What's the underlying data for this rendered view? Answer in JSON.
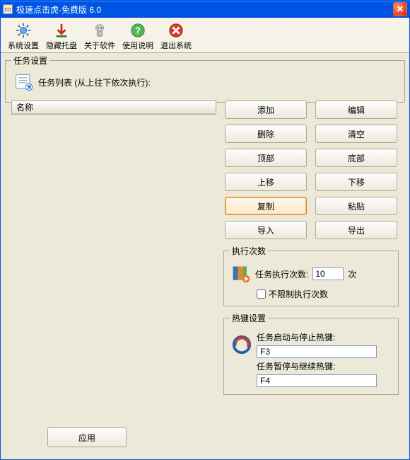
{
  "window": {
    "title": "极速点击虎-免费版 6.0"
  },
  "toolbar": {
    "items": [
      {
        "label": "系统设置"
      },
      {
        "label": "隐藏托盘"
      },
      {
        "label": "关于软件"
      },
      {
        "label": "使用说明"
      },
      {
        "label": "退出系统"
      }
    ]
  },
  "task_settings": {
    "legend": "任务设置",
    "list_caption": "任务列表 (从上往下依次执行):",
    "column_header": "名称",
    "buttons": {
      "add": "添加",
      "edit": "编辑",
      "delete": "删除",
      "clear": "清空",
      "top": "顶部",
      "bottom": "底部",
      "up": "上移",
      "down": "下移",
      "copy": "复制",
      "paste": "粘贴",
      "import": "导入",
      "export": "导出"
    },
    "exec": {
      "legend": "执行次数",
      "label": "任务执行次数:",
      "value": "10",
      "unit": "次",
      "unlimited_label": "不限制执行次数",
      "unlimited_checked": false
    },
    "hotkey": {
      "legend": "热键设置",
      "start_stop_label": "任务启动与停止热键:",
      "start_stop_value": "F3",
      "pause_resume_label": "任务暂停与继续热键:",
      "pause_resume_value": "F4"
    }
  },
  "footer": {
    "apply": "应用"
  }
}
